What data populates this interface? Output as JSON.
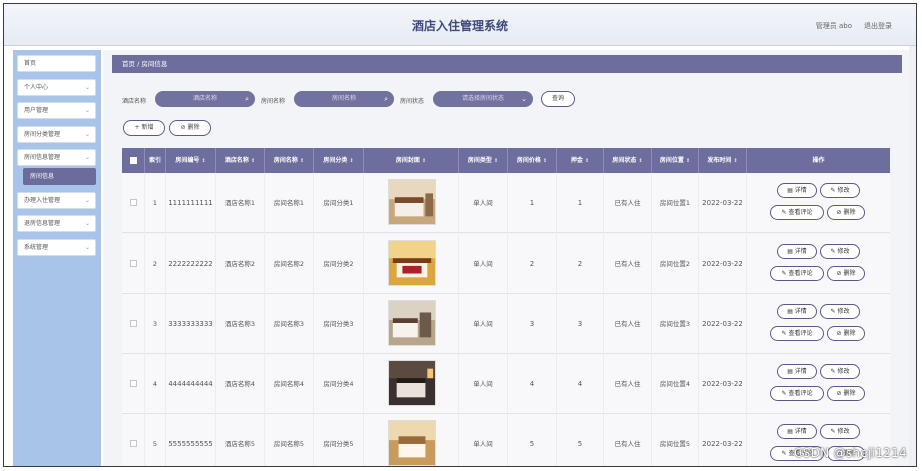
{
  "header": {
    "title": "酒店入住管理系统",
    "admin": "管理员 abo",
    "logout": "退出登录"
  },
  "sidebar": {
    "items": [
      {
        "label": "首页",
        "expandable": false
      },
      {
        "label": "个人中心",
        "expandable": true
      },
      {
        "label": "用户管理",
        "expandable": true
      },
      {
        "label": "房间分类管理",
        "expandable": true
      },
      {
        "label": "房间信息管理",
        "expandable": true
      },
      {
        "label": "房间信息",
        "expandable": false,
        "active": true
      },
      {
        "label": "办理入住管理",
        "expandable": true
      },
      {
        "label": "退房信息管理",
        "expandable": true
      },
      {
        "label": "系统管理",
        "expandable": true
      }
    ],
    "chevron": "⌄"
  },
  "breadcrumb": {
    "home": "首页",
    "sep": "/",
    "current": "房间信息"
  },
  "search": {
    "hotel_label": "酒店名称",
    "hotel_placeholder": "酒店名称",
    "room_label": "房间名称",
    "room_placeholder": "房间名称",
    "status_label": "房间状态",
    "status_placeholder": "请选择房间状态",
    "query_button": "查询"
  },
  "actions": {
    "add": "+ 新增",
    "delete": "⊘ 删除"
  },
  "table": {
    "columns": [
      "索引",
      "房间编号",
      "酒店名称",
      "房间名称",
      "房间分类",
      "房间封面",
      "房间类型",
      "房间价格",
      "押金",
      "房间状态",
      "房间位置",
      "发布时间",
      "操作"
    ],
    "sort_icon": "⇕",
    "rows": [
      {
        "index": "1",
        "room_no": "1111111111",
        "hotel": "酒店名称1",
        "room_name": "房间名称1",
        "category": "房间分类1",
        "type": "单人间",
        "price": "1",
        "deposit": "1",
        "status": "已有人住",
        "location": "房间位置1",
        "date": "2022-03-22"
      },
      {
        "index": "2",
        "room_no": "2222222222",
        "hotel": "酒店名称2",
        "room_name": "房间名称2",
        "category": "房间分类2",
        "type": "单人间",
        "price": "2",
        "deposit": "2",
        "status": "已有人住",
        "location": "房间位置2",
        "date": "2022-03-22"
      },
      {
        "index": "3",
        "room_no": "3333333333",
        "hotel": "酒店名称3",
        "room_name": "房间名称3",
        "category": "房间分类3",
        "type": "单人间",
        "price": "3",
        "deposit": "3",
        "status": "已有人住",
        "location": "房间位置3",
        "date": "2022-03-22"
      },
      {
        "index": "4",
        "room_no": "4444444444",
        "hotel": "酒店名称4",
        "room_name": "房间名称4",
        "category": "房间分类4",
        "type": "单人间",
        "price": "4",
        "deposit": "4",
        "status": "已有人住",
        "location": "房间位置4",
        "date": "2022-03-22"
      },
      {
        "index": "5",
        "room_no": "5555555555",
        "hotel": "酒店名称5",
        "room_name": "房间名称5",
        "category": "房间分类5",
        "type": "单人间",
        "price": "5",
        "deposit": "5",
        "status": "已有人住",
        "location": "房间位置5",
        "date": "2022-03-22"
      }
    ],
    "row_actions": {
      "detail": "▤ 详情",
      "edit": "✎ 修改",
      "review": "✎ 查看评论",
      "delete": "⊘ 删除"
    }
  },
  "watermark": "CSDN @sheji1214",
  "colors": {
    "accent": "#6d6d9e",
    "sidebar": "#a8c4e8",
    "header": "#e9edf5"
  }
}
